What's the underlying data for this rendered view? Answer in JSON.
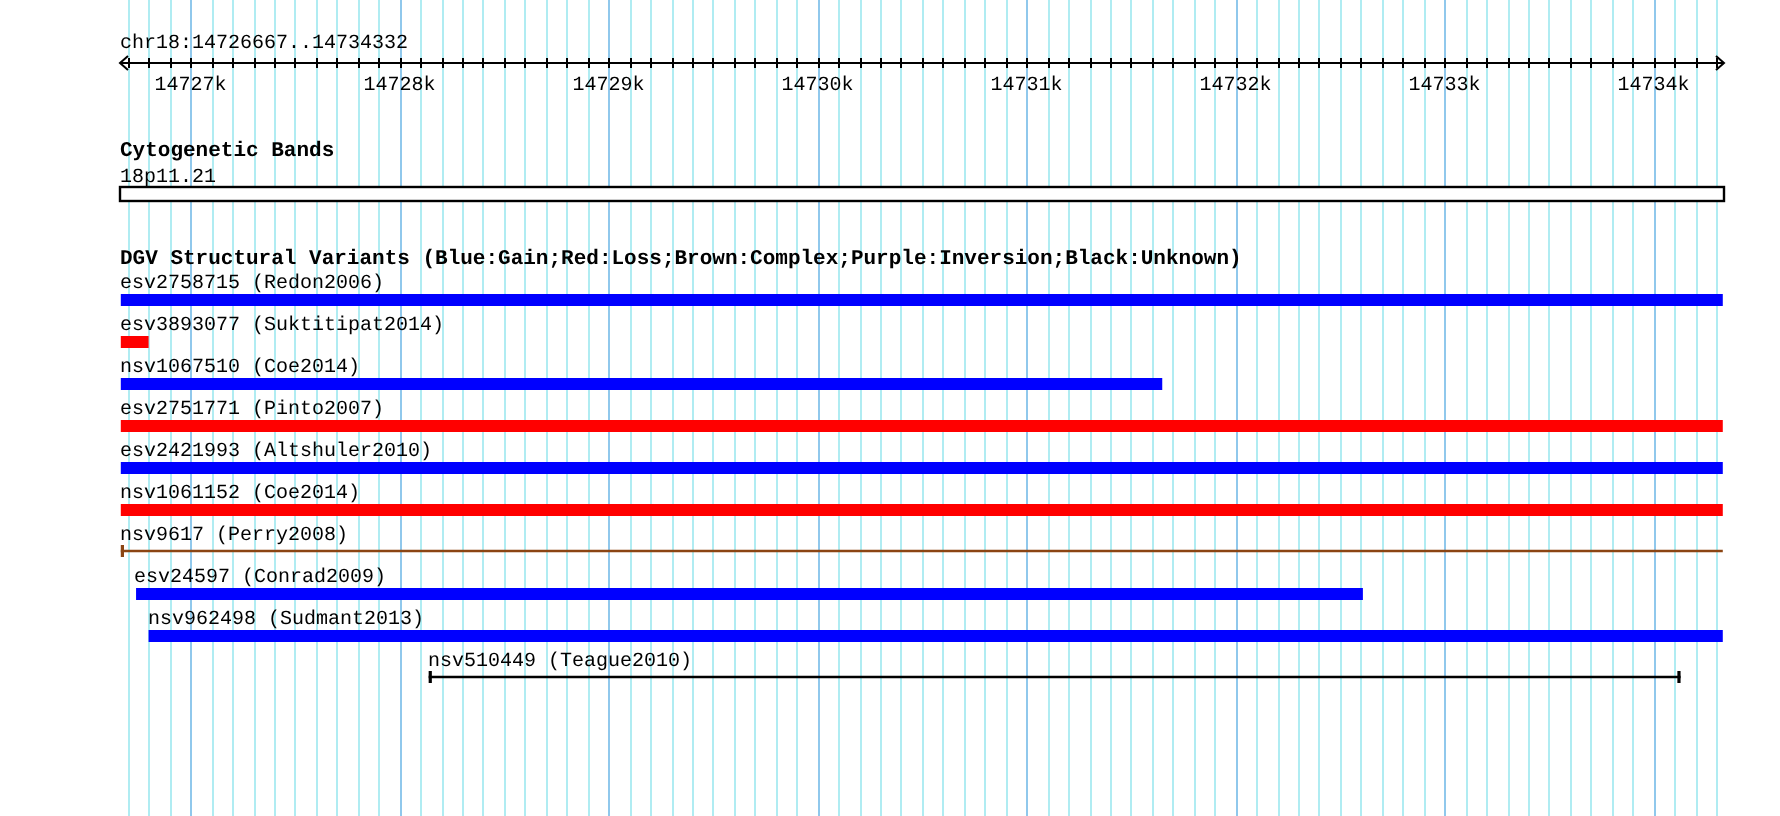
{
  "ruler": {
    "title": "chr18:14726667..14734332",
    "ticks": [
      "14727k",
      "14728k",
      "14729k",
      "14730k",
      "14731k",
      "14732k",
      "14733k",
      "14734k"
    ]
  },
  "tracks": [
    {
      "title": "Cytogenetic Bands",
      "features": [
        {
          "label": "18p11.21",
          "kind": "band"
        }
      ]
    },
    {
      "title": "DGV Structural Variants (Blue:Gain;Red:Loss;Brown:Complex;Purple:Inversion;Black:Unknown)",
      "features": [
        {
          "label": "esv2758715 (Redon2006)",
          "kind": "bar",
          "color": "#0000ff"
        },
        {
          "label": "esv3893077 (Suktitipat2014)",
          "kind": "bar",
          "color": "#ff0000"
        },
        {
          "label": "nsv1067510 (Coe2014)",
          "kind": "bar",
          "color": "#0000ff"
        },
        {
          "label": "esv2751771 (Pinto2007)",
          "kind": "bar",
          "color": "#ff0000"
        },
        {
          "label": "esv2421993 (Altshuler2010)",
          "kind": "bar",
          "color": "#0000ff"
        },
        {
          "label": "nsv1061152 (Coe2014)",
          "kind": "bar",
          "color": "#ff0000"
        },
        {
          "label": "nsv9617 (Perry2008)",
          "kind": "span",
          "color": "#8b4513"
        },
        {
          "label": "esv24597 (Conrad2009)",
          "kind": "bar",
          "color": "#0000ff"
        },
        {
          "label": "nsv962498 (Sudmant2013)",
          "kind": "bar",
          "color": "#0000ff"
        },
        {
          "label": "nsv510449 (Teague2010)",
          "kind": "span",
          "color": "#000000"
        }
      ]
    }
  ]
}
